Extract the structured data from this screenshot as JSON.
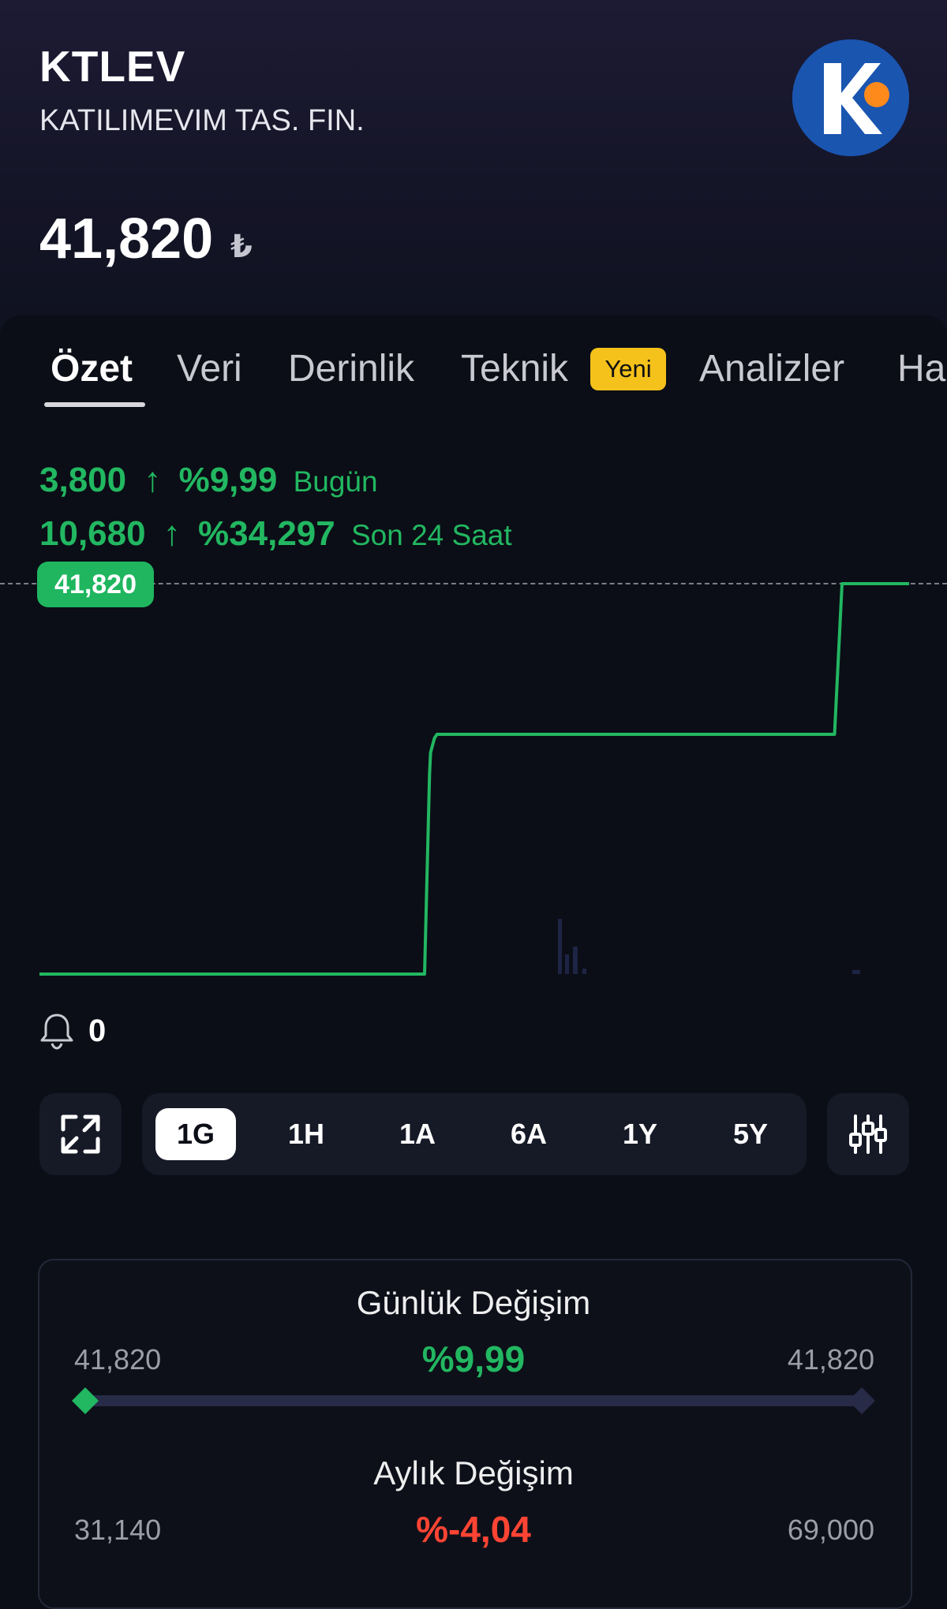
{
  "stock": {
    "ticker": "KTLEV",
    "company": "KATILIMEVIM TAS. FIN.",
    "price": "41,820",
    "currency": "₺"
  },
  "tabs": [
    {
      "label": "Özet"
    },
    {
      "label": "Veri"
    },
    {
      "label": "Derinlik"
    },
    {
      "label": "Teknik"
    },
    {
      "label": "Analizler"
    },
    {
      "label": "Ha"
    }
  ],
  "tab_badge": "Yeni",
  "changes": {
    "today": {
      "value": "3,800",
      "arrow": "↑",
      "percent": "%9,99",
      "label": "Bugün"
    },
    "day24": {
      "value": "10,680",
      "arrow": "↑",
      "percent": "%34,297",
      "label": "Son 24 Saat"
    }
  },
  "chart_price_label": "41,820",
  "chart_data": {
    "type": "line",
    "color": "#22b761",
    "x": [
      0,
      0.775,
      0.785,
      0.787,
      0.795,
      0.8,
      1.6,
      1.615,
      1.75
    ],
    "y": [
      31.14,
      31.14,
      36.6,
      37.2,
      37.6,
      37.7,
      37.7,
      41.82,
      41.82
    ],
    "ylim": [
      31.14,
      41.82
    ],
    "reference_line": 41.82
  },
  "alerts": {
    "count": "0"
  },
  "ranges": {
    "items": [
      {
        "label": "1G",
        "active": true
      },
      {
        "label": "1H",
        "active": false
      },
      {
        "label": "1A",
        "active": false
      },
      {
        "label": "6A",
        "active": false
      },
      {
        "label": "1Y",
        "active": false
      },
      {
        "label": "5Y",
        "active": false
      }
    ]
  },
  "daily_change": {
    "title": "Günlük Değişim",
    "low": "41,820",
    "high": "41,820",
    "percent": "%9,99",
    "position": 0
  },
  "monthly_change": {
    "title": "Aylık Değişim",
    "low": "31,140",
    "high": "69,000",
    "percent": "%-4,04"
  },
  "colors": {
    "up": "#22b761",
    "down": "#ff4433",
    "badge": "#f5c21b",
    "background": "#0b0e16"
  }
}
